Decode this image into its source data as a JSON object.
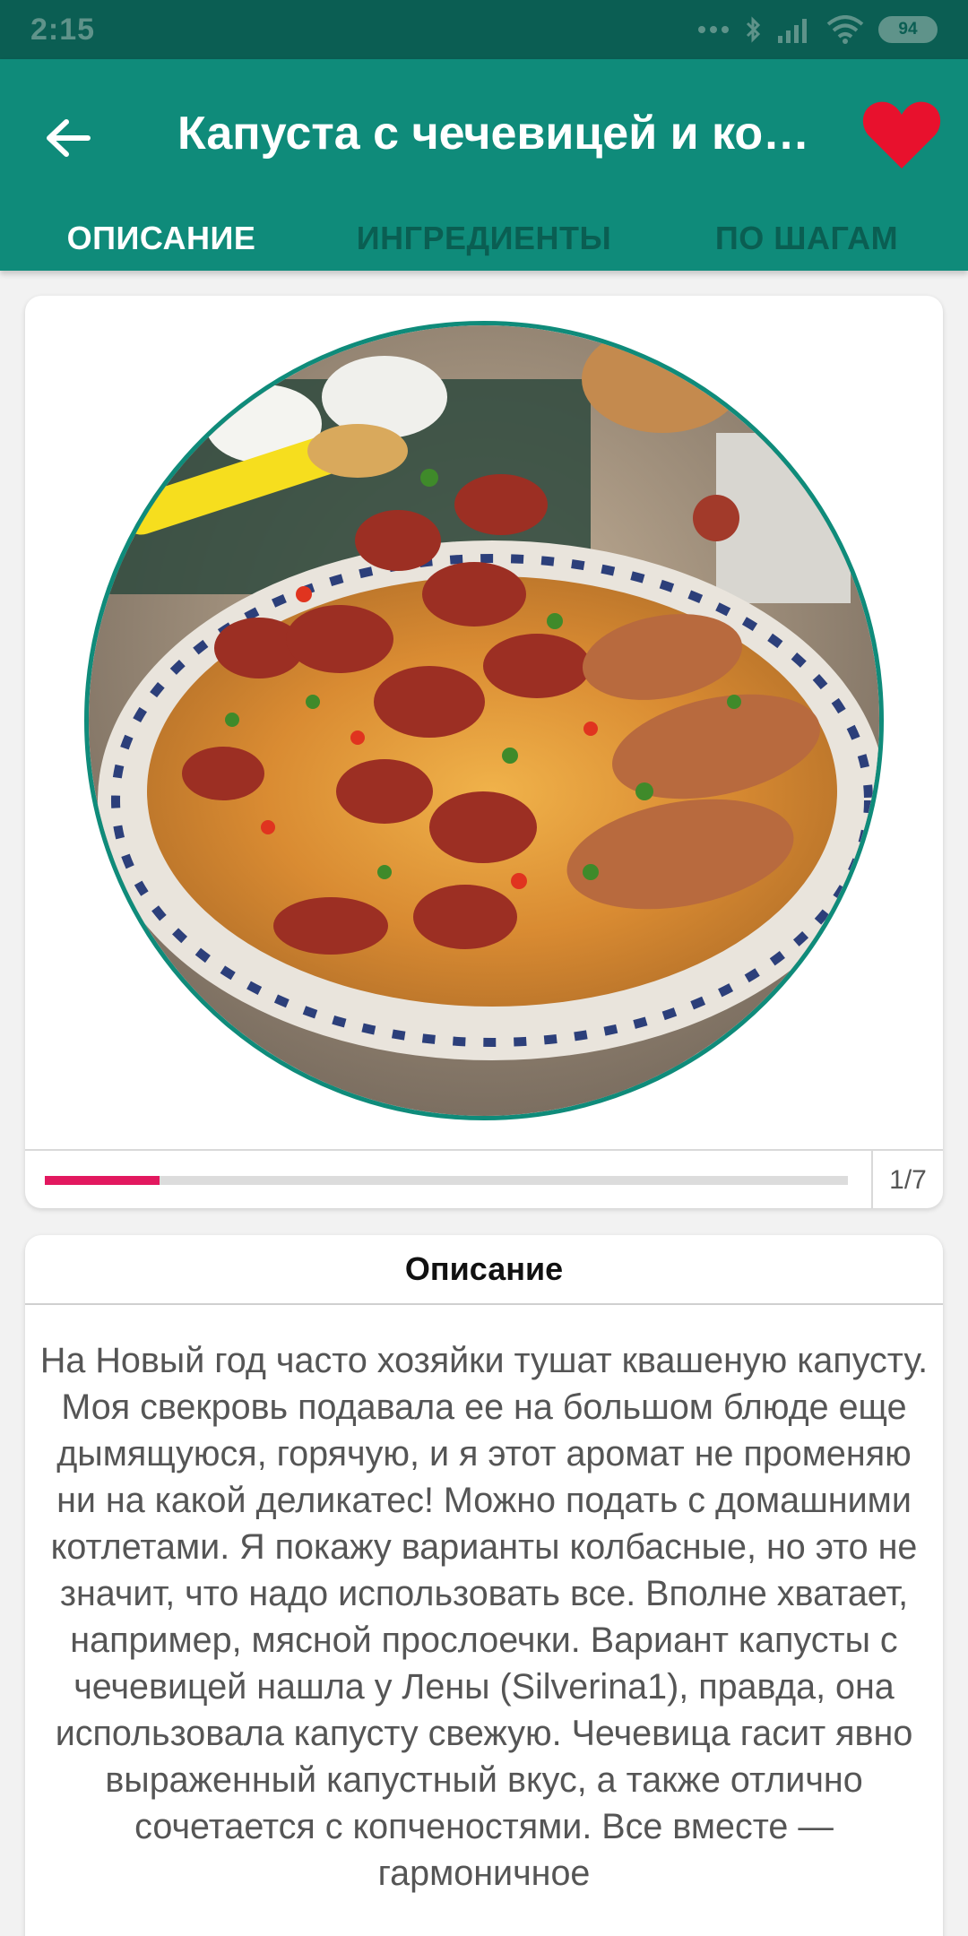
{
  "status_bar": {
    "time": "2:15",
    "battery": "94",
    "icons": [
      "dots-icon",
      "bluetooth-icon",
      "signal-icon",
      "wifi-icon",
      "battery-icon"
    ]
  },
  "app_bar": {
    "title": "Капуста с чечевицей и копченостями",
    "back_icon": "arrow-back-icon",
    "favorite_icon": "heart-icon",
    "favorite_color": "#e8112d"
  },
  "tabs": [
    {
      "label": "ОПИСАНИЕ",
      "active": true
    },
    {
      "label": "ИНГРЕДИЕНТЫ",
      "active": false
    },
    {
      "label": "ПО ШАГАМ",
      "active": false
    }
  ],
  "gallery": {
    "counter": "1/7",
    "current": 1,
    "total": 7,
    "progress_color": "#e2185f"
  },
  "description": {
    "header": "Описание",
    "text": "На Новый год часто хозяйки тушат квашеную капусту. Моя свекровь подавала ее на большом блюде еще дымящуюся, горячую, и я этот аромат не променяю ни на какой деликатес! Можно подать с домашними котлетами. Я покажу варианты колбасные, но это не значит, что надо использовать все. Вполне хватает, например, мясной прослоечки. Вариант капусты с чечевицей нашла у Лены (Silverina1), правда, она использовала капусту свежую. Чечевица гасит явно выраженный капустный вкус, а также отлично сочетается с копченостями. Все вместе — гармоничное"
  },
  "colors": {
    "primary": "#0f8b7a",
    "primary_dark": "#0b5e53",
    "tab_inactive": "#0a5e52"
  }
}
